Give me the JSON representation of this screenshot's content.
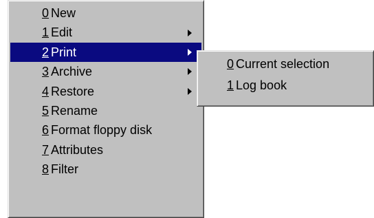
{
  "main_menu": {
    "items": [
      {
        "num": "0",
        "label": "New",
        "submenu": false
      },
      {
        "num": "1",
        "label": "Edit",
        "submenu": true
      },
      {
        "num": "2",
        "label": "Print",
        "submenu": true,
        "active": true
      },
      {
        "num": "3",
        "label": "Archive",
        "submenu": true
      },
      {
        "num": "4",
        "label": "Restore",
        "submenu": true
      },
      {
        "num": "5",
        "label": "Rename",
        "submenu": false
      },
      {
        "num": "6",
        "label": "Format floppy disk",
        "submenu": false
      },
      {
        "num": "7",
        "label": "Attributes",
        "submenu": false
      },
      {
        "num": "8",
        "label": "Filter",
        "submenu": false
      }
    ]
  },
  "sub_menu": {
    "items": [
      {
        "num": "0",
        "label": "Current selection"
      },
      {
        "num": "1",
        "label": "Log book"
      }
    ]
  },
  "colors": {
    "menu_background": "#c0c0c0",
    "highlight": "#0a0a80",
    "highlight_text": "#ffffff"
  }
}
